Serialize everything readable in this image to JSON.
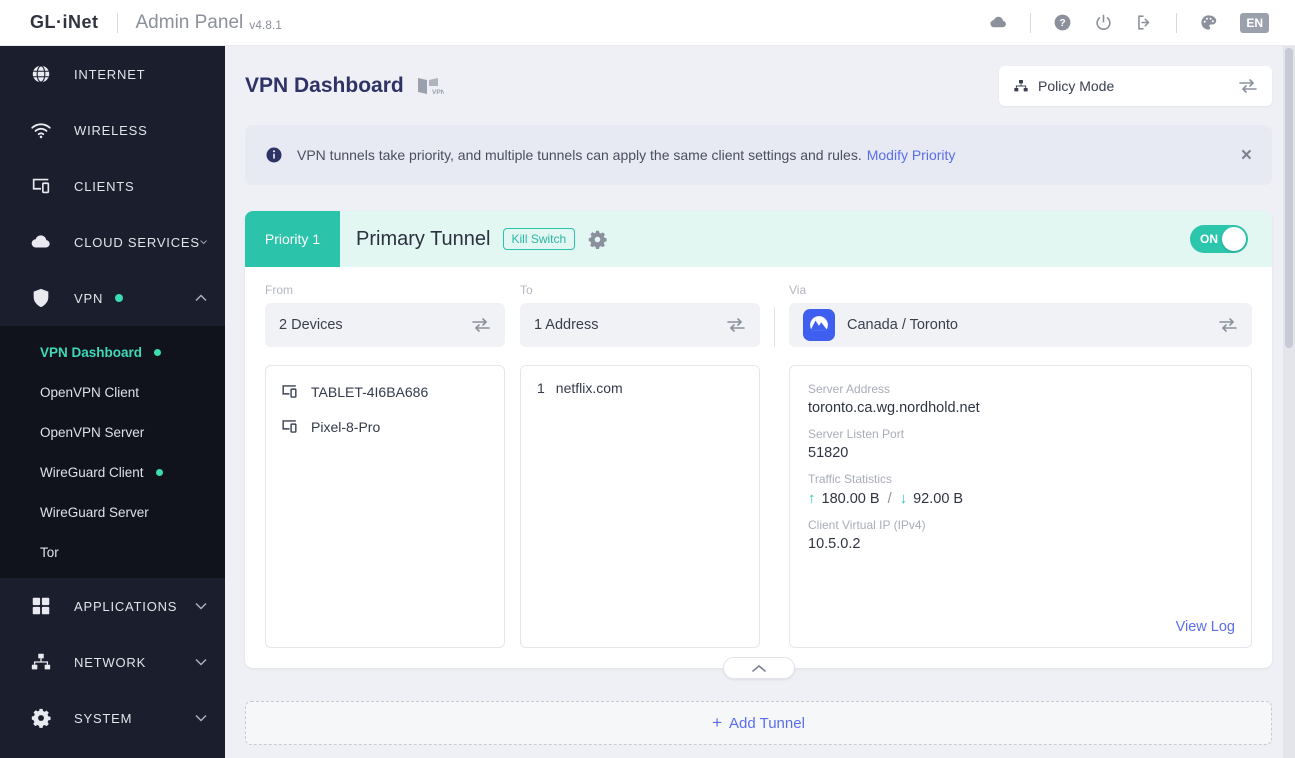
{
  "topbar": {
    "logo": "GL·iNet",
    "title": "Admin Panel",
    "version": "v4.8.1",
    "language": "EN"
  },
  "sidebar": {
    "items": [
      {
        "label": "INTERNET"
      },
      {
        "label": "WIRELESS"
      },
      {
        "label": "CLIENTS"
      },
      {
        "label": "CLOUD SERVICES"
      },
      {
        "label": "VPN"
      }
    ],
    "submenu": [
      {
        "label": "VPN Dashboard"
      },
      {
        "label": "OpenVPN Client"
      },
      {
        "label": "OpenVPN Server"
      },
      {
        "label": "WireGuard Client"
      },
      {
        "label": "WireGuard Server"
      },
      {
        "label": "Tor"
      }
    ],
    "bottom": [
      {
        "label": "APPLICATIONS"
      },
      {
        "label": "NETWORK"
      },
      {
        "label": "SYSTEM"
      }
    ]
  },
  "page": {
    "title": "VPN Dashboard",
    "mode": "Policy Mode"
  },
  "banner": {
    "text": "VPN tunnels take priority, and multiple tunnels can apply the same client settings and rules.",
    "link": "Modify Priority",
    "close": "×"
  },
  "tunnel": {
    "priority": "Priority 1",
    "name": "Primary Tunnel",
    "kill_switch": "Kill Switch",
    "toggle": "ON",
    "from": {
      "label": "From",
      "value": "2 Devices"
    },
    "to": {
      "label": "To",
      "value": "1 Address"
    },
    "via": {
      "label": "Via",
      "value": "Canada / Toronto",
      "provider": "nordvpn"
    },
    "devices": [
      {
        "name": "TABLET-4I6BA686"
      },
      {
        "name": "Pixel-8-Pro"
      }
    ],
    "addresses": [
      {
        "index": "1",
        "host": "netflix.com"
      }
    ],
    "details": {
      "server_address_label": "Server Address",
      "server_address": "toronto.ca.wg.nordhold.net",
      "port_label": "Server Listen Port",
      "port": "51820",
      "traffic_label": "Traffic Statistics",
      "up_arrow": "↑",
      "upload": "180.00 B",
      "slash": "/",
      "down_arrow": "↓",
      "download": "92.00 B",
      "ip_label": "Client Virtual IP (IPv4)",
      "ip": "10.5.0.2"
    },
    "view_log": "View Log"
  },
  "add_tunnel": {
    "plus": "+",
    "label": "Add Tunnel"
  },
  "colors": {
    "accent_teal": "#2cc6ad",
    "link_blue": "#5b6ee9",
    "sidebar_bg": "#1b1e2d",
    "status_dot": "#3ddbb4",
    "nord_blue": "#3e5ff0"
  }
}
